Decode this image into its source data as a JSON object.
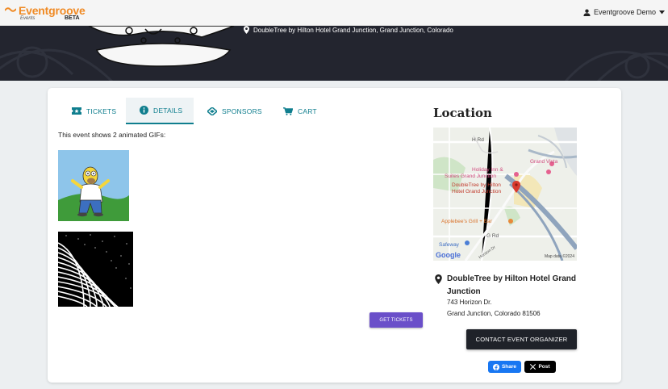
{
  "header": {
    "brand_name": "Eventgroove",
    "brand_sub": "Events",
    "brand_badge": "BETA",
    "user_name": "Eventgroove Demo"
  },
  "banner": {
    "location": "DoubleTree by Hilton Hotel Grand Junction, Grand Junction, Colorado"
  },
  "tabs": [
    {
      "label": "TICKETS",
      "icon": "ticket-icon"
    },
    {
      "label": "DETAILS",
      "icon": "info-icon",
      "active": true
    },
    {
      "label": "SPONSORS",
      "icon": "handshake-icon"
    },
    {
      "label": "CART",
      "icon": "cart-icon"
    }
  ],
  "details": {
    "description": "This event shows 2 animated GIFs:",
    "get_tickets_label": "GET TICKETS"
  },
  "location": {
    "heading": "Location",
    "map_labels": {
      "h_rd": "H Rd",
      "grand_vista": "Grand Vista",
      "holiday_inn": "Holiday Inn &",
      "holiday_inn_2": "Suites Grand Junction",
      "doubletree": "DoubleTree by Hilton",
      "doubletree_2": "Hotel Grand Junction",
      "applebees": "Applebee's Grill + Bar",
      "g_rd": "G Rd",
      "safeway": "Safeway",
      "horizon": "Horizon Dr",
      "google": "Google",
      "copyright": "Map data ©2024"
    },
    "venue_name": "DoubleTree by Hilton Hotel Grand Junction",
    "address_line1": "743 Horizon Dr.",
    "address_line2": "Grand Junction, Colorado 81506",
    "contact_label": "CONTACT EVENT ORGANIZER",
    "share_label": "Share",
    "post_label": "Post"
  },
  "colors": {
    "accent": "#0f7e8e",
    "brand": "#f08a24",
    "primary_button": "#6a4fc9",
    "dark_button": "#1f2229",
    "facebook": "#1877f2"
  }
}
